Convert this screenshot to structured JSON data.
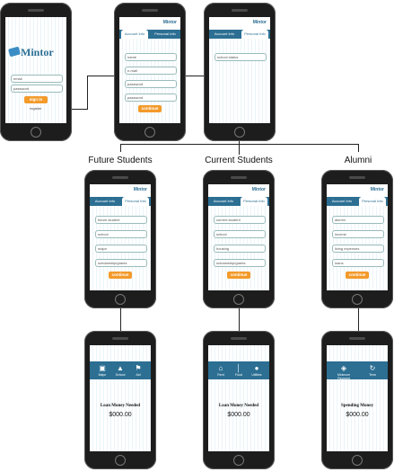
{
  "logo": {
    "text": "Mintor"
  },
  "login": {
    "email": "email",
    "password": "password",
    "signin": "sign in",
    "register": "register"
  },
  "register": {
    "tabs": [
      "Account Info",
      "Personal Info"
    ],
    "fields": [
      "name",
      "e-mail",
      "password",
      "password"
    ],
    "continue": "continue"
  },
  "personal": {
    "tabs": [
      "Account Info",
      "Personal Info"
    ],
    "fields": [
      "school status"
    ]
  },
  "categories": [
    {
      "title": "Future Students",
      "tabs": [
        "Account Info",
        "Personal Info"
      ],
      "fields": [
        "future student",
        "school",
        "major",
        "scholarship/grants"
      ],
      "continue": "continue",
      "summary": {
        "icons": [
          {
            "icon": "book-icon",
            "label": "Major"
          },
          {
            "icon": "bank-icon",
            "label": "School"
          },
          {
            "icon": "flag-icon",
            "label": "Aid"
          }
        ],
        "title": "Loan Money Needed",
        "value": "$000.00"
      }
    },
    {
      "title": "Current Students",
      "tabs": [
        "Account Info",
        "Personal Info"
      ],
      "fields": [
        "current student",
        "school",
        "housing",
        "scholarship/grants"
      ],
      "continue": "continue",
      "summary": {
        "icons": [
          {
            "icon": "house-icon",
            "label": "Rent"
          },
          {
            "icon": "fork-icon",
            "label": "Food"
          },
          {
            "icon": "chat-icon",
            "label": "Utilities"
          }
        ],
        "title": "Loan Money Needed",
        "value": "$000.00"
      }
    },
    {
      "title": "Alumni",
      "tabs": [
        "Account Info",
        "Personal Info"
      ],
      "fields": [
        "alumni",
        "income",
        "living expenses",
        "loans"
      ],
      "continue": "continue",
      "summary": {
        "icons": [
          {
            "icon": "money-icon",
            "label": "Minimum Payment"
          },
          {
            "icon": "refresh-icon",
            "label": "Term"
          }
        ],
        "title": "Spending Money",
        "value": "$000.00"
      }
    }
  ]
}
